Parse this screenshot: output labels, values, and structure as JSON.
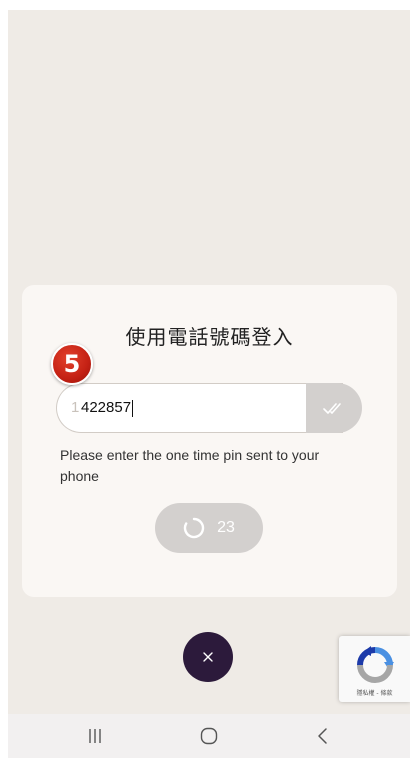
{
  "dialog": {
    "title": "使用電話號碼登入",
    "step_badge": "5",
    "pin_input": {
      "ghost_prefix": "1",
      "value": "422857"
    },
    "verify_button_icon": "double-check-icon",
    "hint": "Please enter the one time pin sent to your phone",
    "resend": {
      "icon": "loading-spinner-icon",
      "countdown": "23"
    }
  },
  "close_button_icon": "close-icon",
  "recaptcha": {
    "icon": "recaptcha-logo-icon",
    "links": "隱私權 - 條款"
  },
  "navbar": {
    "recent_icon": "recent-apps-icon",
    "home_icon": "home-icon",
    "back_icon": "back-icon"
  },
  "colors": {
    "background": "#efebe6",
    "dialog": "#faf7f4",
    "button_disabled": "#d3d0ce",
    "close_button": "#2c1a3b",
    "badge": "#c42114"
  }
}
